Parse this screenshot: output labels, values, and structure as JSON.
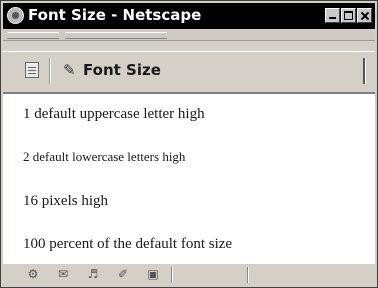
{
  "window": {
    "title": "Font Size - Netscape"
  },
  "toolbar": {
    "title": "Font Size",
    "page_icon": "document-icon",
    "edit_icon": "pen-icon"
  },
  "content": {
    "lines": [
      "1 default uppercase letter high",
      "2 default lowercase letters high",
      "16 pixels high",
      "100 percent of the default font size"
    ]
  },
  "statusbar": {
    "icons": [
      "navigator-icon",
      "mail-icon",
      "composer-icon",
      "edit-icon",
      "address-book-icon"
    ]
  }
}
